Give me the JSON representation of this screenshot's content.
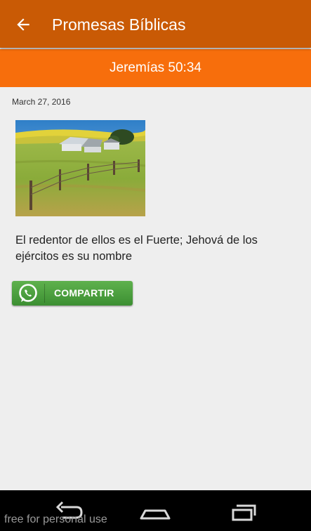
{
  "appbar": {
    "title": "Promesas Bíblicas",
    "back_icon": "arrow-left-icon",
    "background": "#c95a05"
  },
  "subheader": {
    "reference": "Jeremías 50:34",
    "background": "#f76e0c"
  },
  "post": {
    "date": "March 27, 2016",
    "image": "farm-field-photo",
    "verse": "El redentor de ellos es el Fuerte; Jehová de los ejércitos es su nombre"
  },
  "share": {
    "label": "COMPARTIR",
    "icon": "whatsapp-icon",
    "background": "#4ca33f"
  },
  "navbar": {
    "back_icon": "back-nav-icon",
    "home_icon": "home-nav-icon",
    "recents_icon": "recents-nav-icon"
  },
  "watermark": "free for personal use"
}
